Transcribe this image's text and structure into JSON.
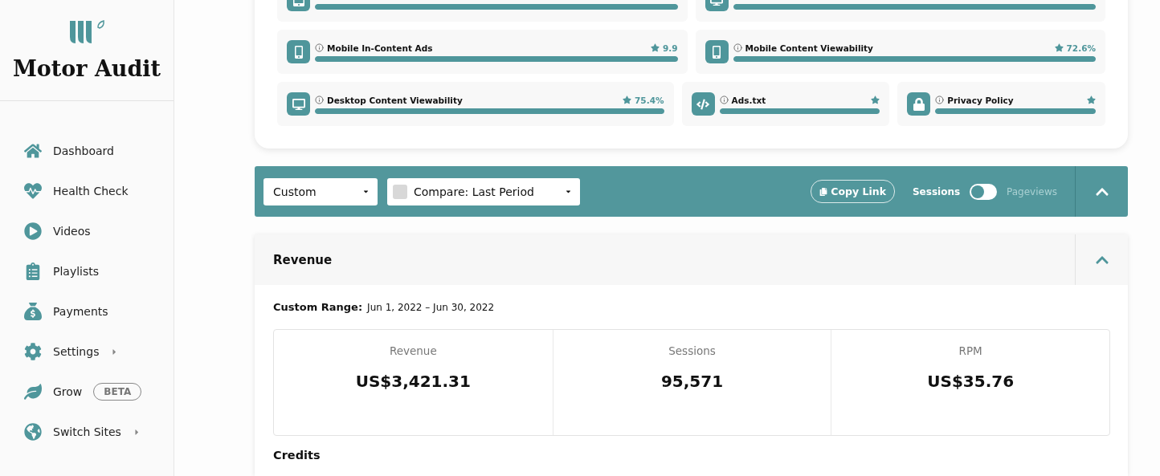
{
  "sidebar": {
    "brand": "Motor Audit",
    "items": [
      {
        "kind": "home",
        "label": "Dashboard"
      },
      {
        "kind": "heartbeat",
        "label": "Health Check"
      },
      {
        "kind": "play",
        "label": "Videos"
      },
      {
        "kind": "list",
        "label": "Playlists"
      },
      {
        "kind": "money",
        "label": "Payments"
      },
      {
        "kind": "gear",
        "label": "Settings",
        "submenu": true
      },
      {
        "kind": "leaf",
        "label": "Grow",
        "badge": "BETA"
      },
      {
        "kind": "globe",
        "label": "Switch Sites",
        "submenu": true
      }
    ]
  },
  "health": {
    "rows": [
      {
        "cards": [
          {
            "kind": "tablet",
            "level": 1
          },
          {
            "kind": "desktop",
            "level": 1
          }
        ]
      },
      {
        "cards": [
          {
            "kind": "mobile",
            "title": "Mobile In-Content Ads",
            "score": "9.9",
            "level": 1
          },
          {
            "kind": "mobile",
            "title": "Mobile Content Viewability",
            "score": "72.6%",
            "level": 1
          }
        ]
      },
      {
        "cards": [
          {
            "kind": "desktop",
            "title": "Desktop Content Viewability",
            "score": "75.4%",
            "level": 1
          },
          {
            "kind": "code",
            "title": "Ads.txt",
            "level": 1
          },
          {
            "kind": "lock",
            "title": "Privacy Policy",
            "level": 1
          }
        ]
      }
    ]
  },
  "toolbar": {
    "range": "Custom",
    "compare": "Compare: Last Period",
    "compare_checked": false,
    "copy_link": "Copy Link",
    "toggle_left": "Sessions",
    "toggle_right": "Pageviews",
    "toggle_on": false
  },
  "revenue": {
    "title": "Revenue",
    "range_label": "Custom Range:",
    "range_value": "Jun 1, 2022 – Jun 30, 2022",
    "stats": [
      {
        "label": "Revenue",
        "value": "US$3,421.31"
      },
      {
        "label": "Sessions",
        "value": "95,571"
      },
      {
        "label": "RPM",
        "value": "US$35.76"
      }
    ],
    "credits_title": "Credits"
  }
}
